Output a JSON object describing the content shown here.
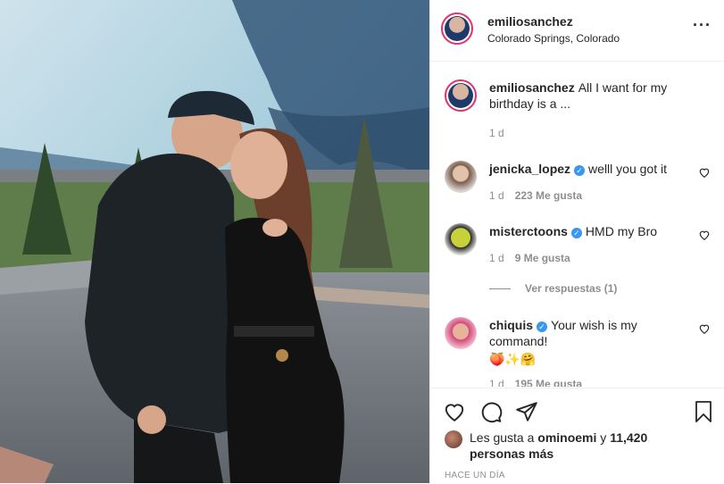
{
  "post": {
    "username": "emiliosanchez",
    "location": "Colorado Springs, Colorado",
    "more_icon": "more-options-icon"
  },
  "caption": {
    "username": "emiliosanchez",
    "text": "All I want for my birthday is a ...",
    "time": "1 d"
  },
  "comments": [
    {
      "username": "jenicka_lopez",
      "verified": true,
      "text": "welll you got it",
      "time": "1 d",
      "likes": "223 Me gusta"
    },
    {
      "username": "misterctoons",
      "verified": true,
      "text": "HMD my Bro",
      "time": "1 d",
      "likes": "9 Me gusta"
    },
    {
      "username": "chiquis",
      "verified": true,
      "text": "Your wish is my command!",
      "emoji": "🍑✨🤗",
      "time": "1 d",
      "likes": "195 Me gusta"
    }
  ],
  "replies_label": "Ver respuestas (1)",
  "actions": {
    "like_icon": "heart-icon",
    "comment_icon": "comment-icon",
    "share_icon": "share-icon",
    "save_icon": "bookmark-icon"
  },
  "likes": {
    "prefix": "Les gusta a",
    "user": "ominoemi",
    "conj": "y",
    "count_text": "11,420 personas más"
  },
  "timestamp": "HACE UN DÍA",
  "colors": {
    "verified": "#3897f0",
    "muted": "#8e8e8e",
    "text": "#262626",
    "story_ring": "#e1306c"
  }
}
